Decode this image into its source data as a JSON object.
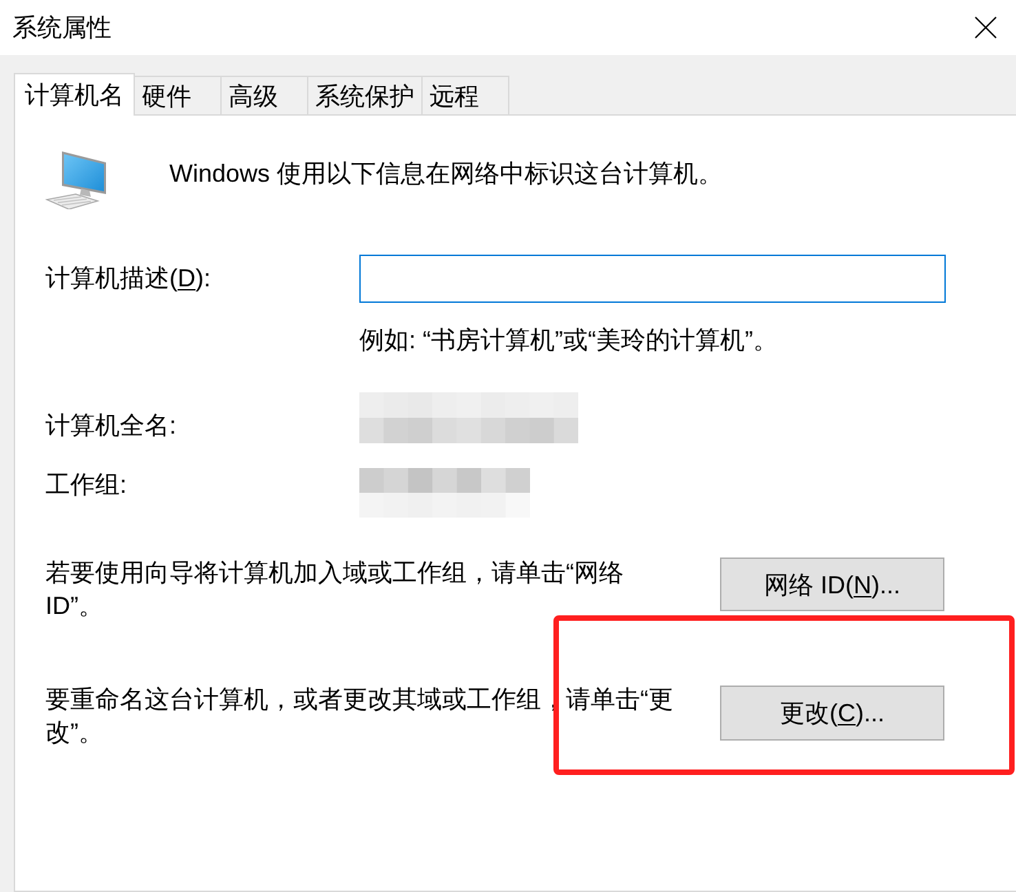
{
  "window": {
    "title": "系统属性"
  },
  "tabs": [
    {
      "label": "计算机名",
      "selected": true
    },
    {
      "label": "硬件",
      "selected": false
    },
    {
      "label": "高级",
      "selected": false
    },
    {
      "label": "系统保护",
      "selected": false
    },
    {
      "label": "远程",
      "selected": false
    }
  ],
  "intro": {
    "text": "Windows 使用以下信息在网络中标识这台计算机。"
  },
  "description": {
    "label": {
      "before": "计算机描述(",
      "access_key": "D",
      "after": "):"
    },
    "focused": true,
    "hint": "例如: “书房计算机”或“美玲的计算机”。"
  },
  "info_rows": [
    {
      "label": "计算机全名:",
      "redacted": true
    },
    {
      "label": "工作组:",
      "redacted": true
    }
  ],
  "actions": [
    {
      "text": "若要使用向导将计算机加入域或工作组，请单击“网络 ID”。",
      "button": {
        "before": "网络 ID(",
        "access_key": "N",
        "after": ")..."
      },
      "highlighted": false
    },
    {
      "text": "要重命名这台计算机，或者更改其域或工作组，请单击“更改”。",
      "button": {
        "before": "更改(",
        "access_key": "C",
        "after": ")..."
      },
      "highlighted": true
    }
  ]
}
